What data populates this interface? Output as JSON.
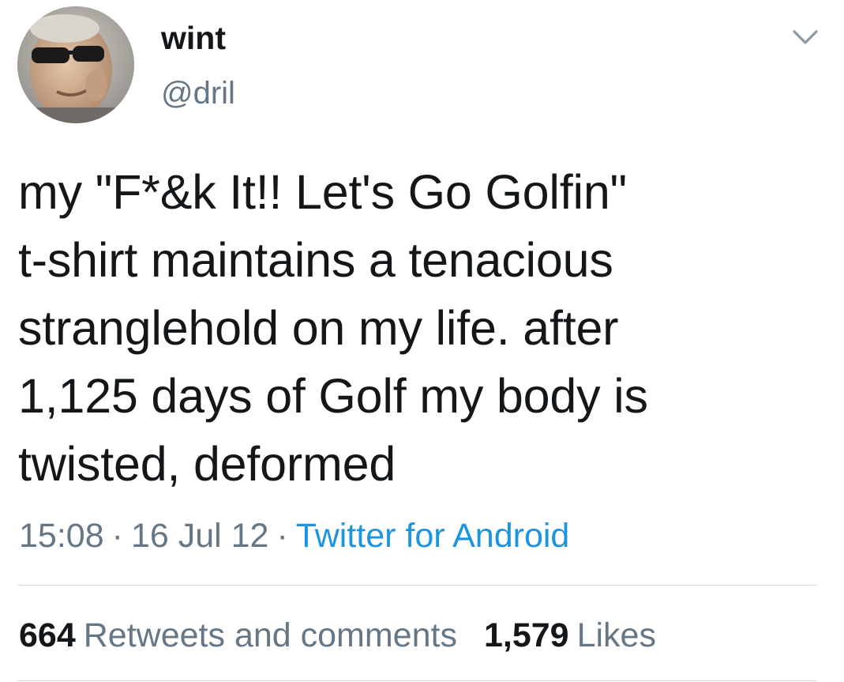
{
  "author": {
    "display_name": "wint",
    "handle": "@dril"
  },
  "icons": {
    "avatar": "profile-photo-man-with-sunglasses",
    "menu": "chevron-down-icon"
  },
  "tweet": {
    "text_lines": [
      "my \"F*&k It!! Let's Go Golfin\"",
      "t-shirt maintains a tenacious",
      "stranglehold on my life. after",
      "1,125 days of Golf my body is",
      "twisted, deformed"
    ],
    "time": "15:08",
    "date": "16 Jul 12",
    "separator": "·",
    "source": "Twitter for Android"
  },
  "stats": {
    "retweets_count": "664",
    "retweets_label": "Retweets and comments",
    "likes_count": "1,579",
    "likes_label": "Likes"
  },
  "colors": {
    "text": "#14171a",
    "secondary": "#657786",
    "link": "#1b95e0",
    "divider": "#d5dce1",
    "background": "#ffffff"
  }
}
